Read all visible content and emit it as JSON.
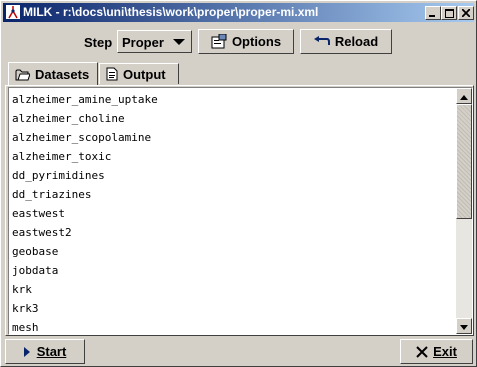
{
  "window": {
    "title": "MILK - r:\\docs\\uni\\thesis\\work\\proper\\proper-mi.xml",
    "controls": [
      "minimize",
      "maximize",
      "close"
    ]
  },
  "toolbar": {
    "step_label": "Step",
    "step_value": "Proper",
    "options_label": "Options",
    "reload_label": "Reload"
  },
  "tabs": [
    {
      "label": "Datasets",
      "icon": "folder-icon",
      "active": true
    },
    {
      "label": "Output",
      "icon": "document-icon",
      "active": false
    }
  ],
  "datasets": {
    "items": [
      "alzheimer_amine_uptake",
      "alzheimer_choline",
      "alzheimer_scopolamine",
      "alzheimer_toxic",
      "dd_pyrimidines",
      "dd_triazines",
      "eastwest",
      "eastwest2",
      "geobase",
      "jobdata",
      "krk",
      "krk3",
      "mesh"
    ]
  },
  "bottom": {
    "start_label": "Start",
    "exit_label": "Exit"
  },
  "colors": {
    "titlebar_start": "#0a246a",
    "titlebar_end": "#a6caf0",
    "face": "#d4d0c8",
    "start_arrow": "#0a246a"
  }
}
